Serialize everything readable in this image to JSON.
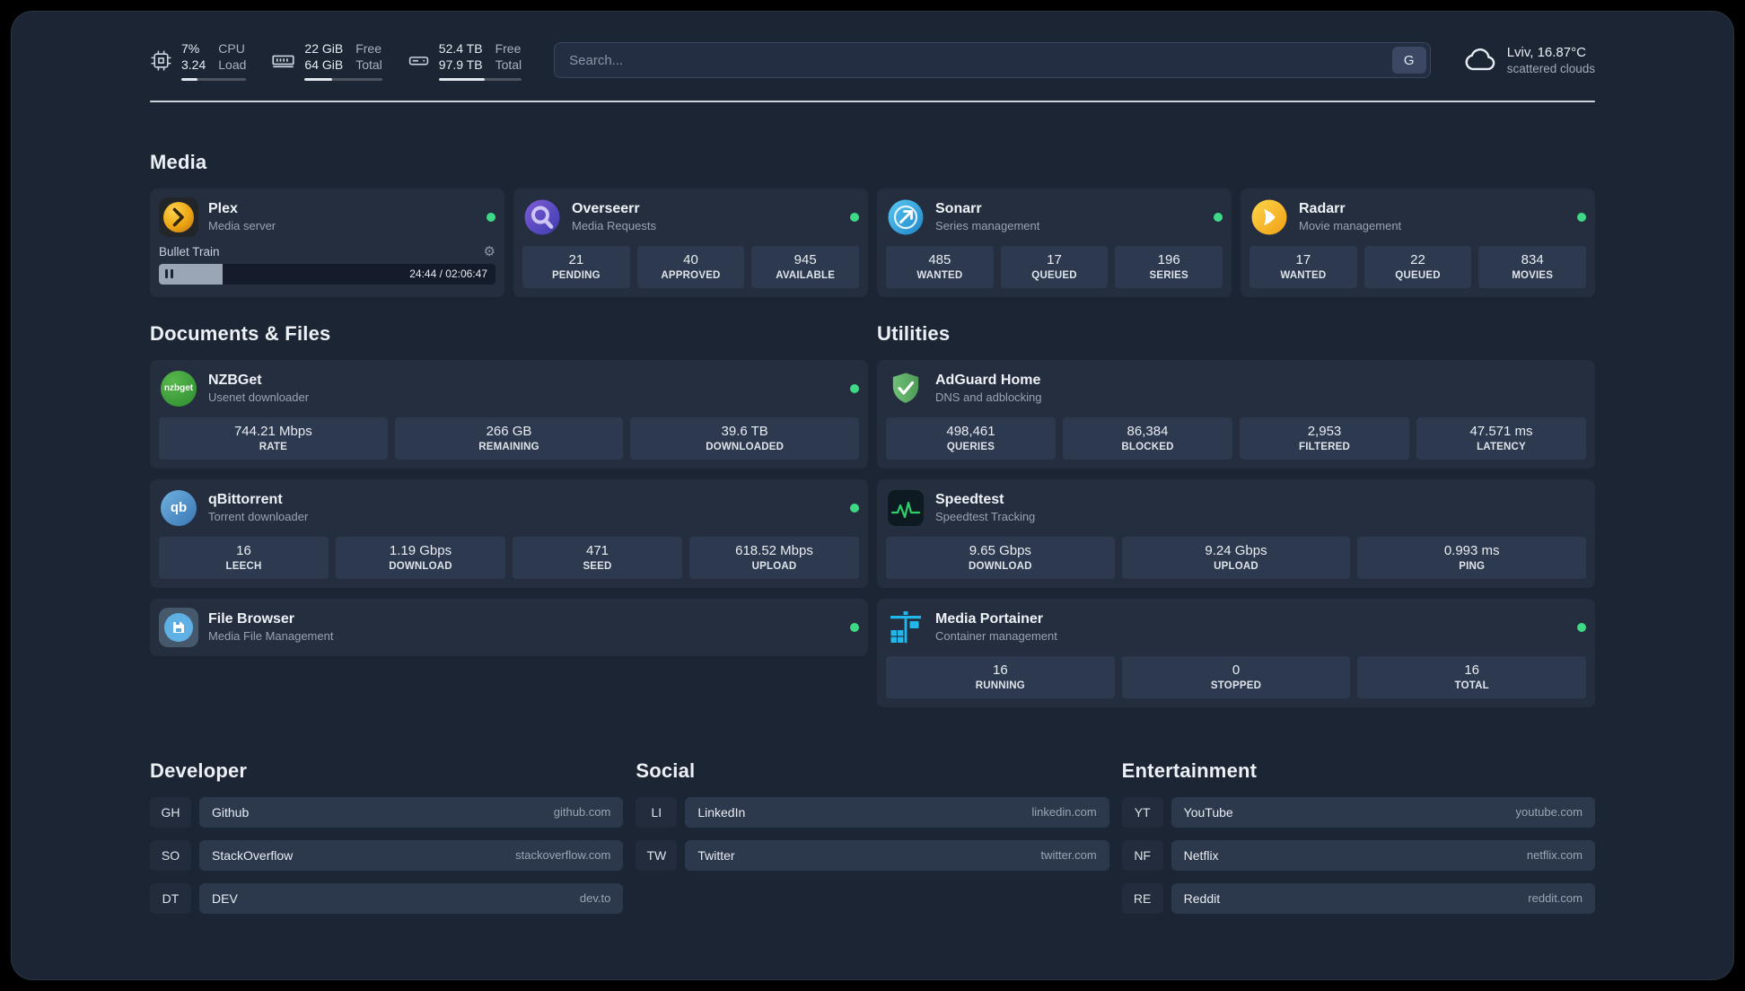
{
  "theme": {
    "page_bg": "#000000",
    "dashboard_bg": "#1c2534",
    "card_bg": "#242e3f",
    "stat_bg": "#2d394e",
    "status_online": "#3fd985",
    "text_primary": "#e9edf3",
    "text_secondary": "#98a2b3"
  },
  "topbar": {
    "cpu": {
      "values": [
        "7%",
        "3.24"
      ],
      "labels": [
        "CPU",
        "Load"
      ],
      "percent": 25
    },
    "memory": {
      "values": [
        "22 GiB",
        "64 GiB"
      ],
      "labels": [
        "Free",
        "Total"
      ],
      "percent": 35
    },
    "disk": {
      "values": [
        "52.4 TB",
        "97.9 TB"
      ],
      "labels": [
        "Free",
        "Total"
      ],
      "percent": 55
    },
    "search": {
      "placeholder": "Search...",
      "provider": "G"
    },
    "weather": {
      "location": "Lviv, 16.87°C",
      "condition": "scattered clouds"
    }
  },
  "sections": {
    "media": {
      "title": "Media"
    },
    "documents": {
      "title": "Documents & Files"
    },
    "utilities": {
      "title": "Utilities"
    },
    "developer": {
      "title": "Developer"
    },
    "social": {
      "title": "Social"
    },
    "entertainment": {
      "title": "Entertainment"
    }
  },
  "services": {
    "plex": {
      "name": "Plex",
      "subtitle": "Media server",
      "online": true,
      "player": {
        "title": "Bullet Train",
        "time": "24:44 / 02:06:47",
        "progress": 19
      }
    },
    "overseerr": {
      "name": "Overseerr",
      "subtitle": "Media Requests",
      "online": true,
      "stats": [
        {
          "value": "21",
          "label": "PENDING"
        },
        {
          "value": "40",
          "label": "APPROVED"
        },
        {
          "value": "945",
          "label": "AVAILABLE"
        }
      ]
    },
    "sonarr": {
      "name": "Sonarr",
      "subtitle": "Series management",
      "online": true,
      "stats": [
        {
          "value": "485",
          "label": "WANTED"
        },
        {
          "value": "17",
          "label": "QUEUED"
        },
        {
          "value": "196",
          "label": "SERIES"
        }
      ]
    },
    "radarr": {
      "name": "Radarr",
      "subtitle": "Movie management",
      "online": true,
      "stats": [
        {
          "value": "17",
          "label": "WANTED"
        },
        {
          "value": "22",
          "label": "QUEUED"
        },
        {
          "value": "834",
          "label": "MOVIES"
        }
      ]
    },
    "nzbget": {
      "name": "NZBGet",
      "subtitle": "Usenet downloader",
      "online": true,
      "icon_text": "nzbget",
      "stats": [
        {
          "value": "744.21 Mbps",
          "label": "RATE"
        },
        {
          "value": "266 GB",
          "label": "REMAINING"
        },
        {
          "value": "39.6 TB",
          "label": "DOWNLOADED"
        }
      ]
    },
    "qbittorrent": {
      "name": "qBittorrent",
      "subtitle": "Torrent downloader",
      "online": true,
      "icon_text": "qb",
      "stats": [
        {
          "value": "16",
          "label": "LEECH"
        },
        {
          "value": "1.19 Gbps",
          "label": "DOWNLOAD"
        },
        {
          "value": "471",
          "label": "SEED"
        },
        {
          "value": "618.52 Mbps",
          "label": "UPLOAD"
        }
      ]
    },
    "filebrowser": {
      "name": "File Browser",
      "subtitle": "Media File Management",
      "online": true
    },
    "adguard": {
      "name": "AdGuard Home",
      "subtitle": "DNS and adblocking",
      "stats": [
        {
          "value": "498,461",
          "label": "QUERIES"
        },
        {
          "value": "86,384",
          "label": "BLOCKED"
        },
        {
          "value": "2,953",
          "label": "FILTERED"
        },
        {
          "value": "47.571 ms",
          "label": "LATENCY"
        }
      ]
    },
    "speedtest": {
      "name": "Speedtest",
      "subtitle": "Speedtest Tracking",
      "stats": [
        {
          "value": "9.65 Gbps",
          "label": "DOWNLOAD"
        },
        {
          "value": "9.24 Gbps",
          "label": "UPLOAD"
        },
        {
          "value": "0.993 ms",
          "label": "PING"
        }
      ]
    },
    "portainer": {
      "name": "Media Portainer",
      "subtitle": "Container management",
      "online": true,
      "stats": [
        {
          "value": "16",
          "label": "RUNNING"
        },
        {
          "value": "0",
          "label": "STOPPED"
        },
        {
          "value": "16",
          "label": "TOTAL"
        }
      ]
    }
  },
  "bookmarks": {
    "developer": [
      {
        "abbr": "GH",
        "name": "Github",
        "url": "github.com"
      },
      {
        "abbr": "SO",
        "name": "StackOverflow",
        "url": "stackoverflow.com"
      },
      {
        "abbr": "DT",
        "name": "DEV",
        "url": "dev.to"
      }
    ],
    "social": [
      {
        "abbr": "LI",
        "name": "LinkedIn",
        "url": "linkedin.com"
      },
      {
        "abbr": "TW",
        "name": "Twitter",
        "url": "twitter.com"
      }
    ],
    "entertainment": [
      {
        "abbr": "YT",
        "name": "YouTube",
        "url": "youtube.com"
      },
      {
        "abbr": "NF",
        "name": "Netflix",
        "url": "netflix.com"
      },
      {
        "abbr": "RE",
        "name": "Reddit",
        "url": "reddit.com"
      }
    ]
  }
}
